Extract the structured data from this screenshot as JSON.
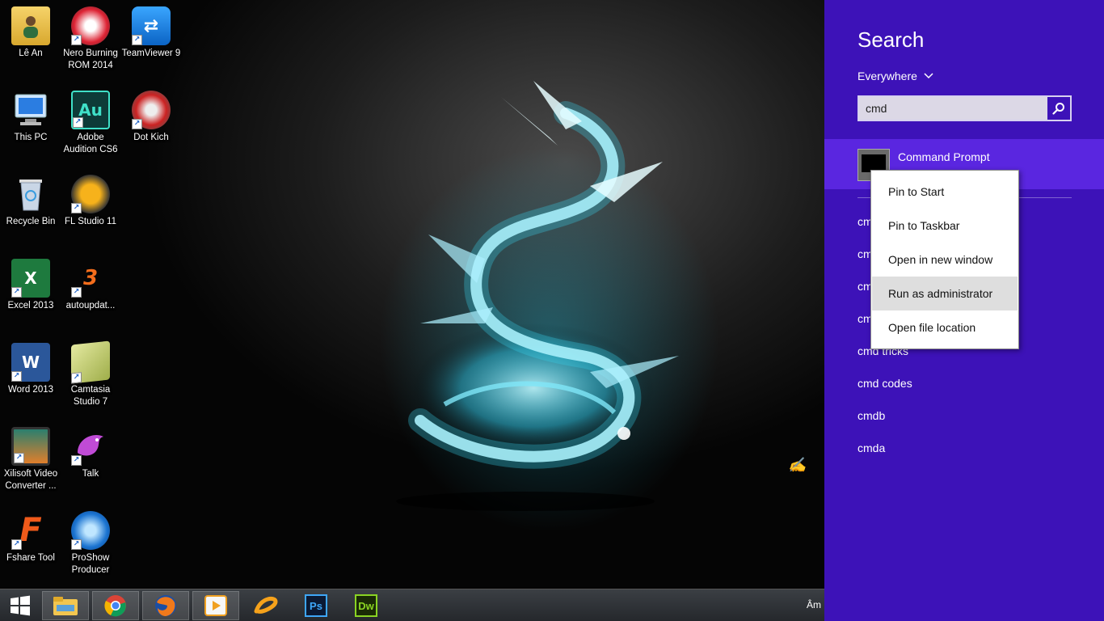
{
  "desktop": {
    "icons": [
      {
        "label": "Lê An",
        "icon": "user-folder-icon",
        "short": false
      },
      {
        "label": "Nero Burning ROM 2014",
        "icon": "nero-icon",
        "short": true
      },
      {
        "label": "TeamViewer 9",
        "icon": "teamviewer-icon",
        "short": true
      },
      {
        "label": "This PC",
        "icon": "computer-icon",
        "short": false
      },
      {
        "label": "Adobe Audition CS6",
        "icon": "audition-icon",
        "short": true,
        "glyph": "Au"
      },
      {
        "label": "Dot Kich",
        "icon": "dotkich-icon",
        "short": true
      },
      {
        "label": "Recycle Bin",
        "icon": "recycle-bin-icon",
        "short": false
      },
      {
        "label": "FL Studio 11",
        "icon": "fl-studio-icon",
        "short": true
      },
      {
        "label": "Excel 2013",
        "icon": "excel-icon",
        "short": true,
        "glyph": "X"
      },
      {
        "label": "autoupdat...",
        "icon": "autoupdate-icon",
        "short": true
      },
      {
        "label": "Word 2013",
        "icon": "word-icon",
        "short": true,
        "glyph": "W"
      },
      {
        "label": "Camtasia Studio 7",
        "icon": "camtasia-icon",
        "short": true
      },
      {
        "label": "Xilisoft Video Converter ...",
        "icon": "xilisoft-icon",
        "short": true
      },
      {
        "label": "Talk",
        "icon": "talk-dolphin-icon",
        "short": true
      },
      {
        "label": "Fshare Tool",
        "icon": "fshare-icon",
        "short": true,
        "glyph": "F"
      },
      {
        "label": "ProShow Producer",
        "icon": "proshow-icon",
        "short": true
      }
    ]
  },
  "taskbar": {
    "items": [
      {
        "icon": "start-windows-icon"
      },
      {
        "icon": "file-explorer-icon"
      },
      {
        "icon": "chrome-icon"
      },
      {
        "icon": "firefox-icon"
      },
      {
        "icon": "media-player-icon"
      },
      {
        "icon": "ie-like-swirl-icon"
      },
      {
        "icon": "photoshop-icon",
        "glyph": "Ps"
      },
      {
        "icon": "dreamweaver-icon",
        "glyph": "Dw"
      }
    ],
    "tray_text": "Âm"
  },
  "search": {
    "title": "Search",
    "scope": "Everywhere",
    "query": "cmd",
    "top_result": "Command Prompt",
    "suggestions": [
      "cmd tricks",
      "cmd codes",
      "cmdb",
      "cmda"
    ],
    "hidden_prefix": "cm"
  },
  "context_menu": {
    "items": [
      "Pin to Start",
      "Pin to Taskbar",
      "Open in new window",
      "Run as administrator",
      "Open file location"
    ],
    "highlighted": "Run as administrator"
  },
  "colors": {
    "charm_bg": "#3d12b8",
    "charm_highlight": "#5a26e0",
    "menu_hover": "#dedede",
    "taskbar": "#2e3236"
  }
}
